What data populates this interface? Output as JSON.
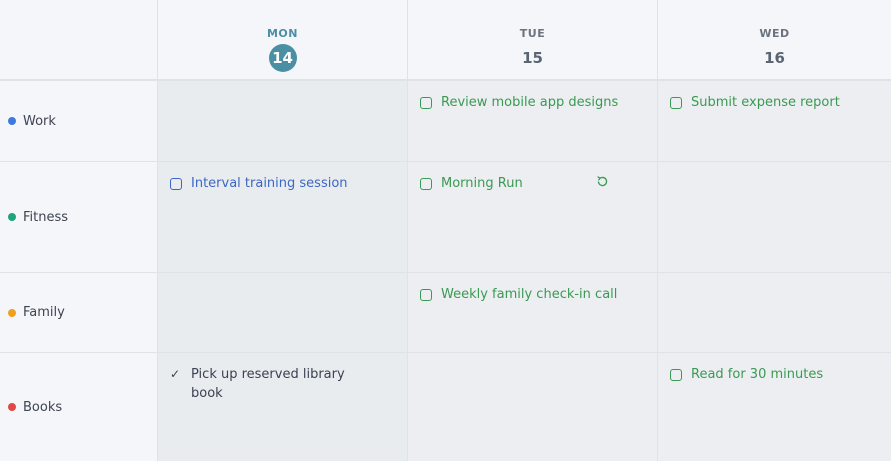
{
  "days": [
    {
      "name": "MON",
      "num": "14",
      "today": true
    },
    {
      "name": "TUE",
      "num": "15",
      "today": false
    },
    {
      "name": "WED",
      "num": "16",
      "today": false
    }
  ],
  "categories": [
    {
      "label": "Work",
      "color": "#3b7be0"
    },
    {
      "label": "Fitness",
      "color": "#1fa37a"
    },
    {
      "label": "Family",
      "color": "#f0a020"
    },
    {
      "label": "Books",
      "color": "#e04848"
    }
  ],
  "tasks": {
    "work_tue": "Review mobile app designs",
    "work_wed": "Submit expense report",
    "fitness_mon": "Interval training session",
    "fitness_tue": "Morning Run",
    "family_tue": "Weekly family check-in call",
    "books_mon_line1": "Pick up reserved library",
    "books_mon_line2": "book",
    "books_wed": "Read for 30 minutes"
  },
  "colors": {
    "today_accent": "#4a8fa3",
    "task_green": "#3a9a52",
    "task_blue": "#3c67c4"
  }
}
